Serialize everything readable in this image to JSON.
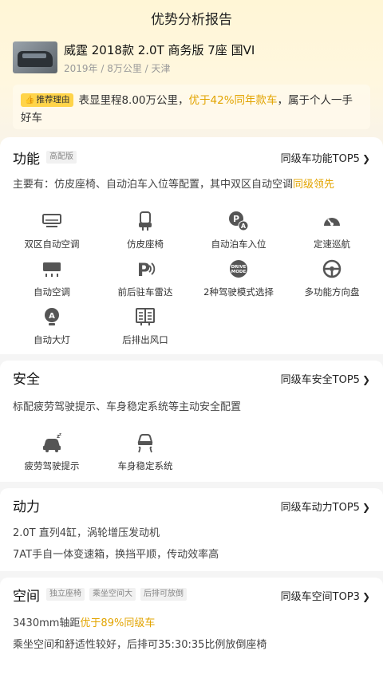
{
  "header": {
    "title": "优势分析报告",
    "car_name": "威霆 2018款 2.0T 商务版 7座 国VI",
    "car_meta": "2019年 / 8万公里 / 天津"
  },
  "reason": {
    "badge": "推荐理由",
    "text_before": "表显里程8.00万公里，",
    "highlight": "优于42%同年款车",
    "text_after": "，属于个人一手好车"
  },
  "sections": {
    "function": {
      "title": "功能",
      "tag": "高配版",
      "link": "同级车功能TOP5",
      "desc_before": "主要有：仿皮座椅、自动泊车入位等配置，其中双区自动空调",
      "desc_highlight": "同级领先",
      "features": [
        {
          "label": "双区自动空调",
          "icon": "dual-ac-icon"
        },
        {
          "label": "仿皮座椅",
          "icon": "seat-icon"
        },
        {
          "label": "自动泊车入位",
          "icon": "auto-park-icon"
        },
        {
          "label": "定速巡航",
          "icon": "cruise-icon"
        },
        {
          "label": "自动空调",
          "icon": "ac-icon"
        },
        {
          "label": "前后驻车雷达",
          "icon": "parking-radar-icon"
        },
        {
          "label": "2种驾驶模式选择",
          "icon": "drive-mode-icon"
        },
        {
          "label": "多功能方向盘",
          "icon": "steering-wheel-icon"
        },
        {
          "label": "自动大灯",
          "icon": "auto-headlight-icon"
        },
        {
          "label": "后排出风口",
          "icon": "rear-vent-icon"
        }
      ]
    },
    "safety": {
      "title": "安全",
      "link": "同级车安全TOP5",
      "desc": "标配疲劳驾驶提示、车身稳定系统等主动安全配置",
      "features": [
        {
          "label": "疲劳驾驶提示",
          "icon": "fatigue-alert-icon"
        },
        {
          "label": "车身稳定系统",
          "icon": "stability-icon"
        }
      ]
    },
    "power": {
      "title": "动力",
      "link": "同级车动力TOP5",
      "line1": "2.0T 直列4缸，涡轮增压发动机",
      "line2": "7AT手自一体变速箱，换挡平顺，传动效率高"
    },
    "space": {
      "title": "空间",
      "tags": [
        "独立座椅",
        "乘坐空间大",
        "后排可放倒"
      ],
      "link": "同级车空间TOP3",
      "line1_before": "3430mm轴距",
      "line1_highlight": "优于89%同级车",
      "line2": "乘坐空间和舒适性较好，后排可35:30:35比例放倒座椅"
    }
  },
  "colors": {
    "accent": "#e2a400",
    "badge": "#ffd449",
    "icon": "#555555"
  }
}
